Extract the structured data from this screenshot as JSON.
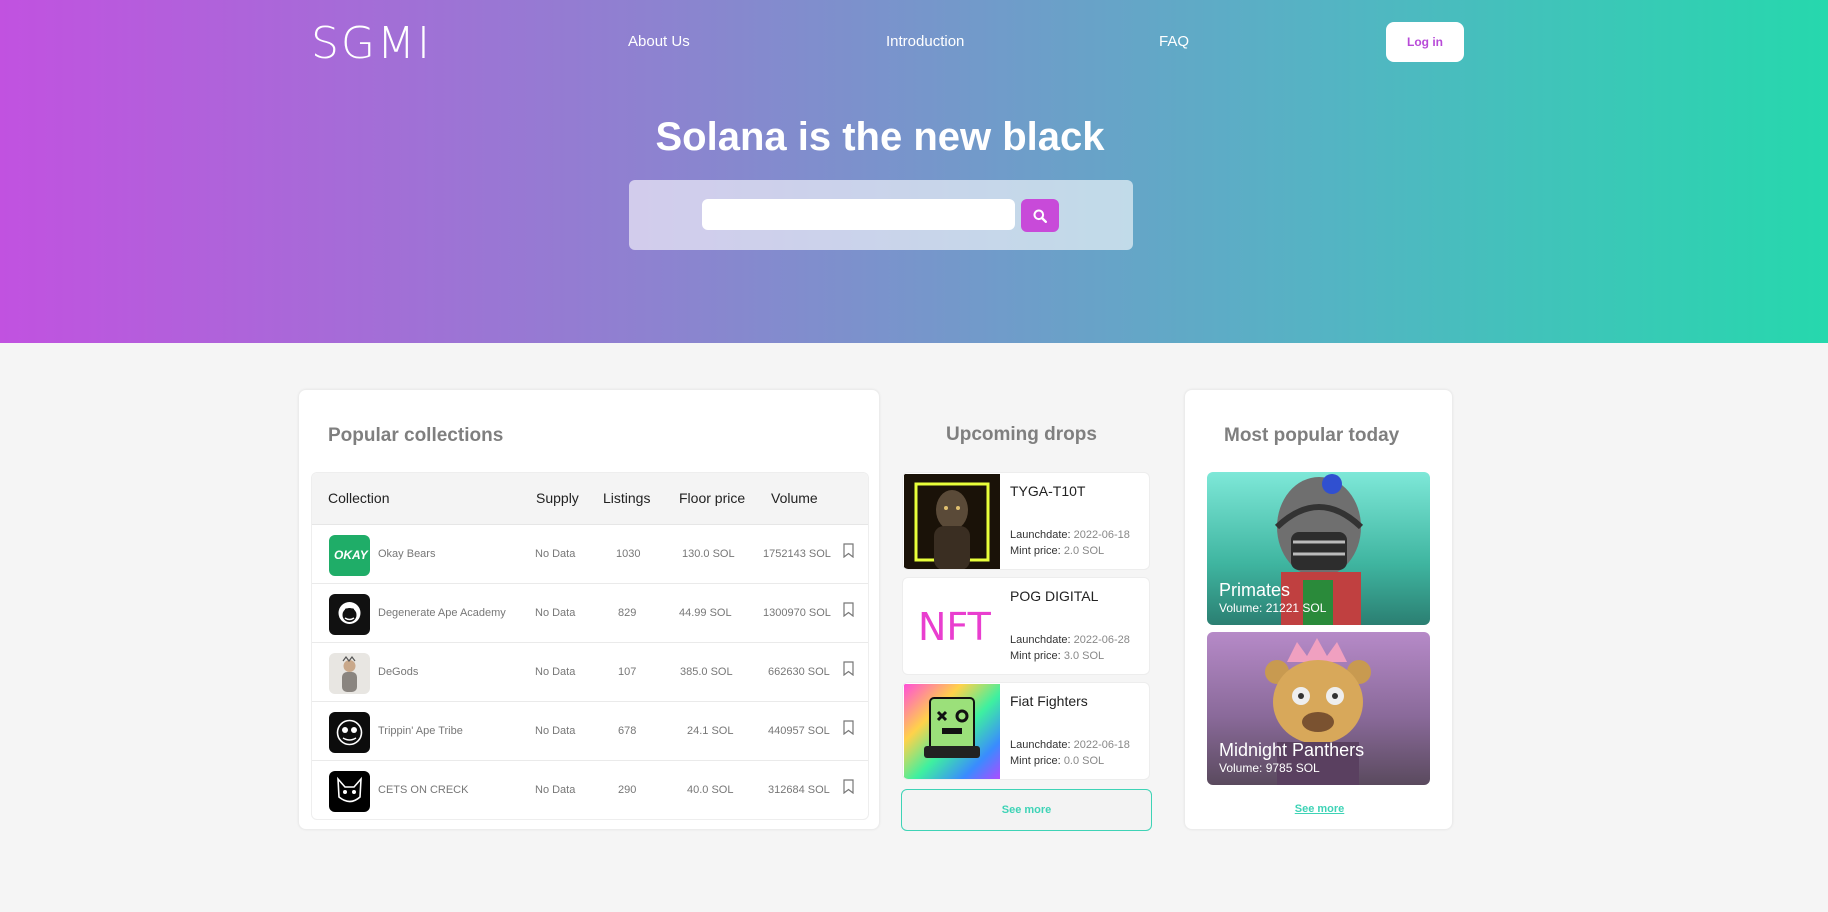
{
  "header": {
    "logo": "SGMI",
    "nav": [
      "About Us",
      "Introduction",
      "FAQ"
    ],
    "login_label": "Log in"
  },
  "hero": {
    "title": "Solana is the new black",
    "search_placeholder": "",
    "search_icon": "search-icon"
  },
  "popular": {
    "title": "Popular collections",
    "columns": [
      "Collection",
      "Supply",
      "Listings",
      "Floor price",
      "Volume"
    ],
    "rows": [
      {
        "name": "Okay Bears",
        "supply": "No Data",
        "listings": "1030",
        "floor": "130.0 SOL",
        "volume": "1752143 SOL"
      },
      {
        "name": "Degenerate Ape Academy",
        "supply": "No Data",
        "listings": "829",
        "floor": "44.99 SOL",
        "volume": "1300970 SOL"
      },
      {
        "name": "DeGods",
        "supply": "No Data",
        "listings": "107",
        "floor": "385.0 SOL",
        "volume": "662630 SOL"
      },
      {
        "name": "Trippin' Ape Tribe",
        "supply": "No Data",
        "listings": "678",
        "floor": "24.1 SOL",
        "volume": "440957 SOL"
      },
      {
        "name": "CETS ON CRECK",
        "supply": "No Data",
        "listings": "290",
        "floor": "40.0 SOL",
        "volume": "312684 SOL"
      }
    ],
    "okay_logo_text": "OKAY"
  },
  "upcoming": {
    "title": "Upcoming drops",
    "launch_label": "Launchdate:",
    "mint_label": "Mint price:",
    "drops": [
      {
        "name": "TYGA-T10T",
        "launch": "2022-06-18",
        "mint": "2.0 SOL"
      },
      {
        "name": "POG DIGITAL",
        "launch": "2022-06-28",
        "mint": "3.0 SOL",
        "img_text": "NFT"
      },
      {
        "name": "Fiat Fighters",
        "launch": "2022-06-18",
        "mint": "0.0 SOL"
      }
    ],
    "see_more": "See more"
  },
  "most_popular": {
    "title": "Most popular today",
    "items": [
      {
        "name": "Primates",
        "volume": "Volume: 21221 SOL"
      },
      {
        "name": "Midnight Panthers",
        "volume": "Volume: 9785 SOL"
      }
    ],
    "see_more": "See more"
  },
  "colors": {
    "accent_purple": "#c84ad9",
    "accent_teal": "#3ed3b6",
    "gradient_start": "#c152e0",
    "gradient_end": "#26d8ad"
  }
}
